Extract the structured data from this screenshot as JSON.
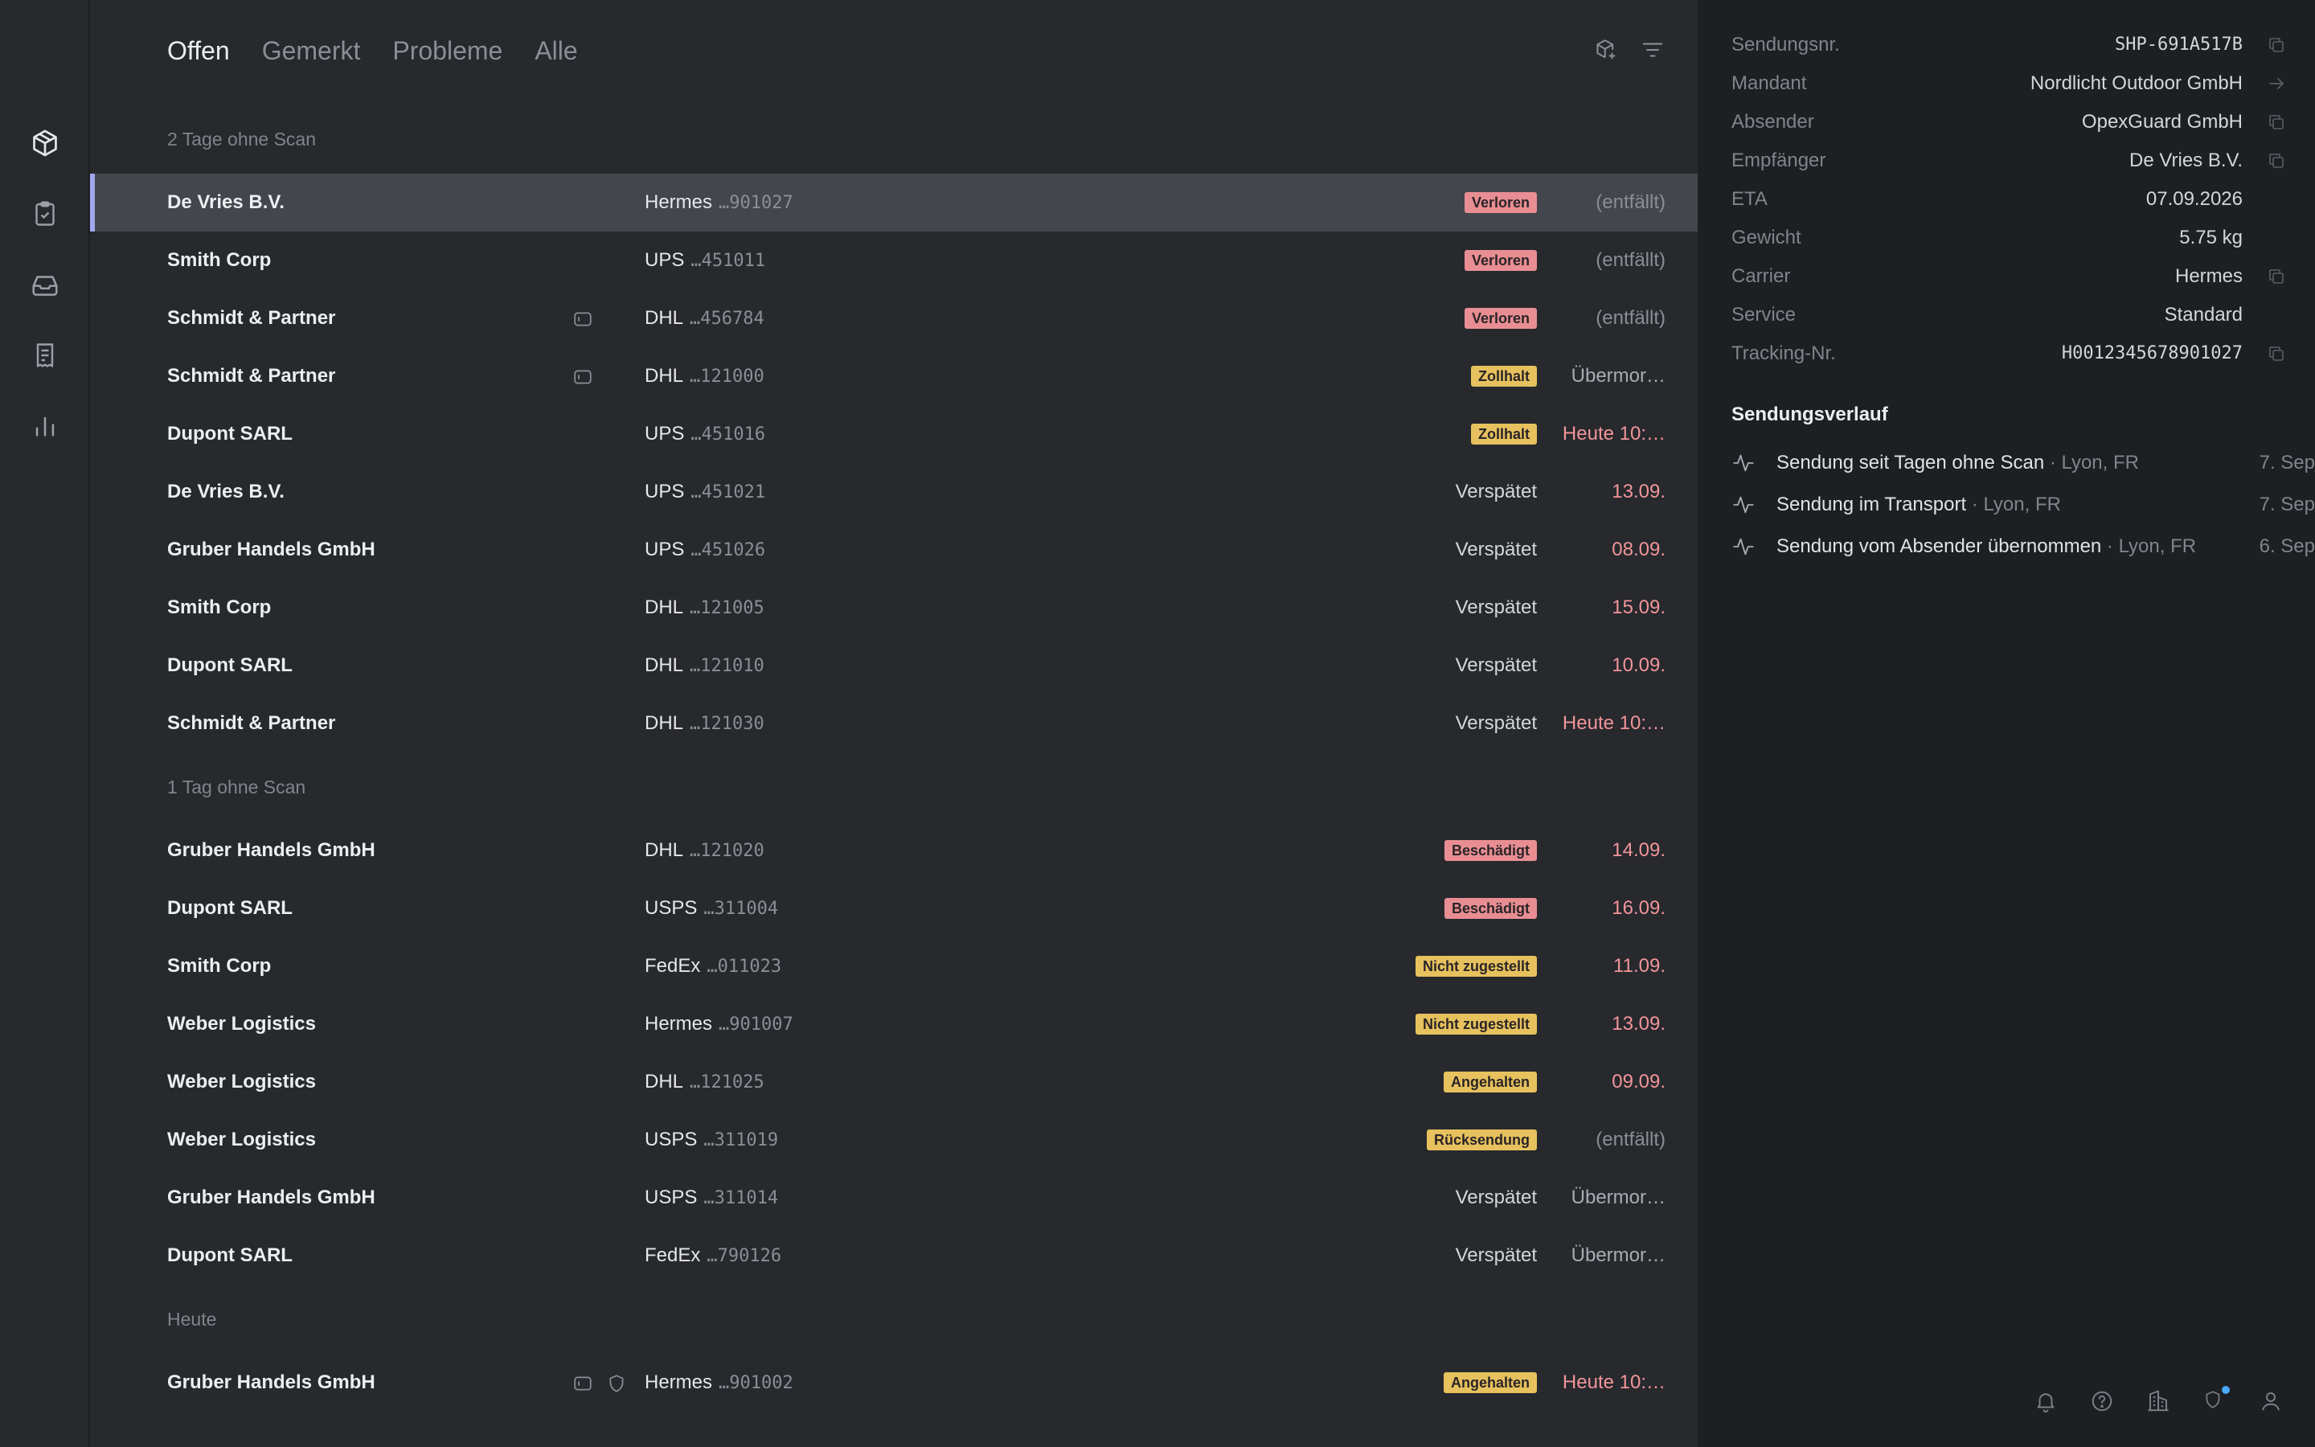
{
  "tabs": [
    "Offen",
    "Gemerkt",
    "Probleme",
    "Alle"
  ],
  "active_tab": "Offen",
  "groups": [
    {
      "header": "2 Tage ohne Scan",
      "rows": [
        {
          "name": "De Vries B.V.",
          "carrier": "Hermes",
          "tracking": "…901027",
          "status": "Verloren",
          "status_style": "badge-red",
          "eta": "(entfällt)",
          "eta_style": "muted",
          "selected": true,
          "flags": []
        },
        {
          "name": "Smith Corp",
          "carrier": "UPS",
          "tracking": "…451011",
          "status": "Verloren",
          "status_style": "badge-red",
          "eta": "(entfällt)",
          "eta_style": "muted",
          "flags": []
        },
        {
          "name": "Schmidt & Partner",
          "carrier": "DHL",
          "tracking": "…456784",
          "status": "Verloren",
          "status_style": "badge-red",
          "eta": "(entfällt)",
          "eta_style": "muted",
          "flags": [
            "note-icon"
          ]
        },
        {
          "name": "Schmidt & Partner",
          "carrier": "DHL",
          "tracking": "…121000",
          "status": "Zollhalt",
          "status_style": "badge-yellow",
          "eta": "Übermor…",
          "eta_style": "yellowish",
          "flags": [
            "note-icon"
          ]
        },
        {
          "name": "Dupont SARL",
          "carrier": "UPS",
          "tracking": "…451016",
          "status": "Zollhalt",
          "status_style": "badge-yellow",
          "eta": "Heute 10:…",
          "eta_style": "red",
          "flags": []
        },
        {
          "name": "De Vries B.V.",
          "carrier": "UPS",
          "tracking": "…451021",
          "status": "Verspätet",
          "status_style": "text",
          "eta": "13.09.",
          "eta_style": "red",
          "flags": []
        },
        {
          "name": "Gruber Handels GmbH",
          "carrier": "UPS",
          "tracking": "…451026",
          "status": "Verspätet",
          "status_style": "text",
          "eta": "08.09.",
          "eta_style": "red",
          "flags": []
        },
        {
          "name": "Smith Corp",
          "carrier": "DHL",
          "tracking": "…121005",
          "status": "Verspätet",
          "status_style": "text",
          "eta": "15.09.",
          "eta_style": "red",
          "flags": []
        },
        {
          "name": "Dupont SARL",
          "carrier": "DHL",
          "tracking": "…121010",
          "status": "Verspätet",
          "status_style": "text",
          "eta": "10.09.",
          "eta_style": "red",
          "flags": []
        },
        {
          "name": "Schmidt & Partner",
          "carrier": "DHL",
          "tracking": "…121030",
          "status": "Verspätet",
          "status_style": "text",
          "eta": "Heute 10:…",
          "eta_style": "red",
          "flags": []
        }
      ]
    },
    {
      "header": "1 Tag ohne Scan",
      "rows": [
        {
          "name": "Gruber Handels GmbH",
          "carrier": "DHL",
          "tracking": "…121020",
          "status": "Beschädigt",
          "status_style": "badge-red",
          "eta": "14.09.",
          "eta_style": "red",
          "flags": []
        },
        {
          "name": "Dupont SARL",
          "carrier": "USPS",
          "tracking": "…311004",
          "status": "Beschädigt",
          "status_style": "badge-red",
          "eta": "16.09.",
          "eta_style": "red",
          "flags": []
        },
        {
          "name": "Smith Corp",
          "carrier": "FedEx",
          "tracking": "…011023",
          "status": "Nicht zugestellt",
          "status_style": "badge-yellow",
          "eta": "11.09.",
          "eta_style": "red",
          "flags": []
        },
        {
          "name": "Weber Logistics",
          "carrier": "Hermes",
          "tracking": "…901007",
          "status": "Nicht zugestellt",
          "status_style": "badge-yellow",
          "eta": "13.09.",
          "eta_style": "red",
          "flags": []
        },
        {
          "name": "Weber Logistics",
          "carrier": "DHL",
          "tracking": "…121025",
          "status": "Angehalten",
          "status_style": "badge-yellow",
          "eta": "09.09.",
          "eta_style": "red",
          "flags": []
        },
        {
          "name": "Weber Logistics",
          "carrier": "USPS",
          "tracking": "…311019",
          "status": "Rücksendung",
          "status_style": "badge-yellow",
          "eta": "(entfällt)",
          "eta_style": "muted",
          "flags": []
        },
        {
          "name": "Gruber Handels GmbH",
          "carrier": "USPS",
          "tracking": "…311014",
          "status": "Verspätet",
          "status_style": "text",
          "eta": "Übermor…",
          "eta_style": "yellowish",
          "flags": []
        },
        {
          "name": "Dupont SARL",
          "carrier": "FedEx",
          "tracking": "…790126",
          "status": "Verspätet",
          "status_style": "text",
          "eta": "Übermor…",
          "eta_style": "yellowish",
          "flags": []
        }
      ]
    },
    {
      "header": "Heute",
      "rows": [
        {
          "name": "Gruber Handels GmbH",
          "carrier": "Hermes",
          "tracking": "…901002",
          "status": "Angehalten",
          "status_style": "badge-yellow",
          "eta": "Heute 10:…",
          "eta_style": "red",
          "flags": [
            "note-icon",
            "shield-icon"
          ]
        }
      ]
    }
  ],
  "details": [
    {
      "label": "Sendungsnr.",
      "value": "SHP-691A517B",
      "mono": true,
      "action": "copy-icon"
    },
    {
      "label": "Mandant",
      "value": "Nordlicht Outdoor GmbH",
      "action": "arrow-right-icon"
    },
    {
      "label": "Absender",
      "value": "OpexGuard GmbH",
      "action": "copy-icon"
    },
    {
      "label": "Empfänger",
      "value": "De Vries B.V.",
      "action": "copy-icon"
    },
    {
      "label": "ETA",
      "value": "07.09.2026"
    },
    {
      "label": "Gewicht",
      "value": "5.75 kg"
    },
    {
      "label": "Carrier",
      "value": "Hermes",
      "action": "copy-icon"
    },
    {
      "label": "Service",
      "value": "Standard"
    },
    {
      "label": "Tracking-Nr.",
      "value": "H0012345678901027",
      "mono": true,
      "action": "copy-icon"
    }
  ],
  "history_title": "Sendungsverlauf",
  "history": [
    {
      "text": "Sendung seit Tagen ohne Scan",
      "location": " · Lyon, FR",
      "date": "7. Sep"
    },
    {
      "text": "Sendung im Transport",
      "location": " · Lyon, FR",
      "date": "7. Sep"
    },
    {
      "text": "Sendung vom Absender übernommen",
      "location": " · Lyon, FR",
      "date": "6. Sep"
    }
  ],
  "nav": [
    "package-icon",
    "clipboard-check-icon",
    "inbox-icon",
    "document-icon",
    "bar-chart-icon"
  ],
  "footer_icons": [
    "bell-icon",
    "help-icon",
    "building-icon",
    "shield-icon",
    "user-icon"
  ],
  "colors": {
    "accent": "#a3a7ef",
    "badge_red": "#e88e93",
    "badge_yellow": "#e6c15d",
    "eta_red": "#f1959a",
    "notification_dot": "#4aa8ff"
  }
}
